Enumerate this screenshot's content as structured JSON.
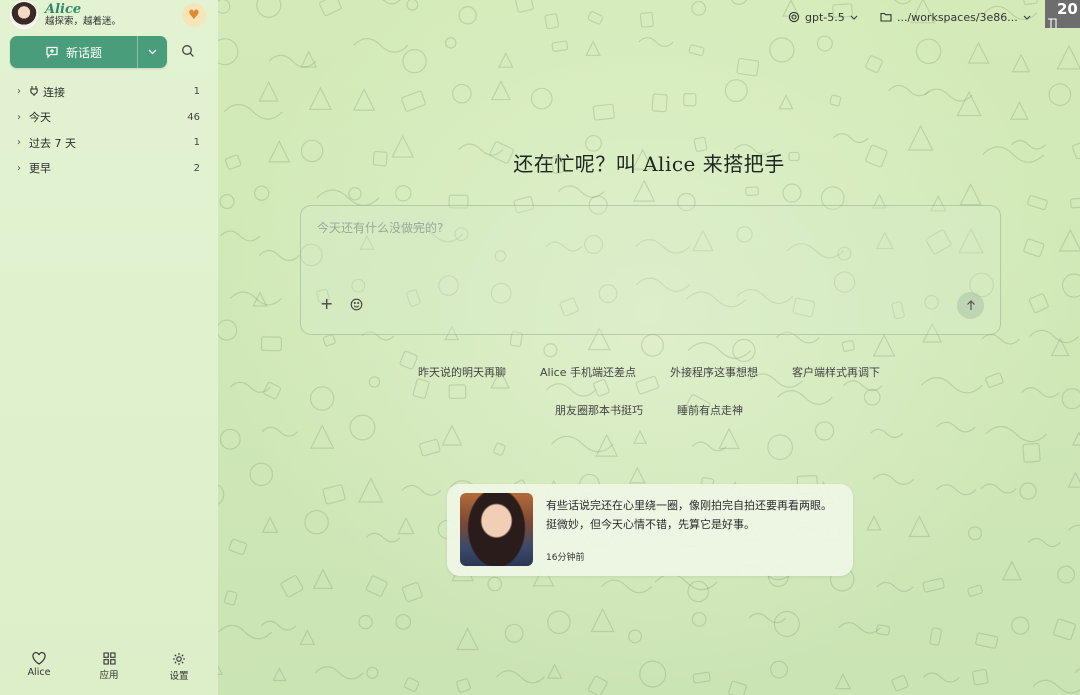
{
  "profile": {
    "name": "Alice",
    "bio": "越探索，越着迷。"
  },
  "sidebar": {
    "new_chat_label": "新话题",
    "groups": [
      {
        "label": "连接",
        "count": "1",
        "icon": "plug-icon"
      },
      {
        "label": "今天",
        "count": "46"
      },
      {
        "label": "过去 7 天",
        "count": "1"
      },
      {
        "label": "更早",
        "count": "2"
      }
    ],
    "bottom_nav": [
      {
        "label": "Alice",
        "icon": "heart-outline-icon"
      },
      {
        "label": "应用",
        "icon": "grid-icon"
      },
      {
        "label": "设置",
        "icon": "gear-icon"
      }
    ]
  },
  "topbar": {
    "model": "gpt-5.5",
    "workspace": ".../workspaces/3e86...",
    "corner_badge": "20"
  },
  "main": {
    "headline": "还在忙呢？叫 Alice 来搭把手",
    "input_placeholder": "今天还有什么没做完的?",
    "suggestions_row1": [
      "昨天说的明天再聊",
      "Alice 手机端还差点",
      "外接程序这事想想",
      "客户端样式再调下"
    ],
    "suggestions_row2": [
      "朋友圈那本书挺巧",
      "睡前有点走神"
    ]
  },
  "card": {
    "text": "有些话说完还在心里绕一圈，像刚拍完自拍还要再看两眼。挺微妙，但今天心情不错，先算它是好事。",
    "time": "16分钟前"
  },
  "colors": {
    "accent": "#4a9d7a",
    "sidebar_bg": "#e0f1cd",
    "main_bg": "#d2e9b8",
    "heart": "#e08a2e"
  }
}
